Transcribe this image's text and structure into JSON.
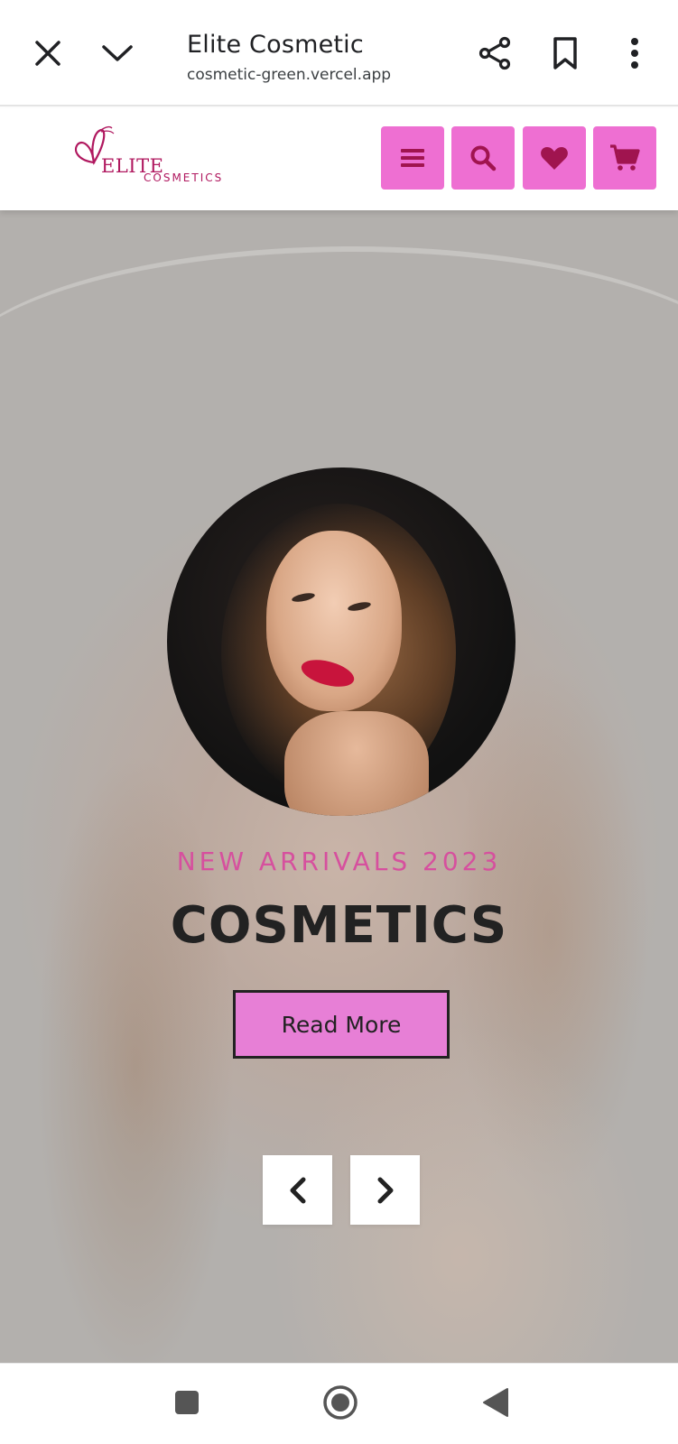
{
  "browser": {
    "title": "Elite Cosmetic",
    "url": "cosmetic-green.vercel.app",
    "icons": [
      "close-icon",
      "chevron-down-icon",
      "share-icon",
      "bookmark-icon",
      "more-vert-icon"
    ]
  },
  "site_header": {
    "logo_main": "ELITE",
    "logo_sub": "COSMETICS",
    "buttons": [
      "menu-icon",
      "search-icon",
      "heart-icon",
      "cart-icon"
    ],
    "accent_color": "#ee6fd2",
    "icon_color": "#a0144f"
  },
  "hero": {
    "subtitle": "NEW ARRIVALS 2023",
    "headline": "COSMETICS",
    "cta_label": "Read More",
    "cta_color": "#e77fd6",
    "subtitle_color": "#d6509e",
    "arrows": [
      "chevron-left-icon",
      "chevron-right-icon"
    ]
  },
  "android_nav": {
    "buttons": [
      "recents-icon",
      "home-icon",
      "back-icon"
    ]
  }
}
